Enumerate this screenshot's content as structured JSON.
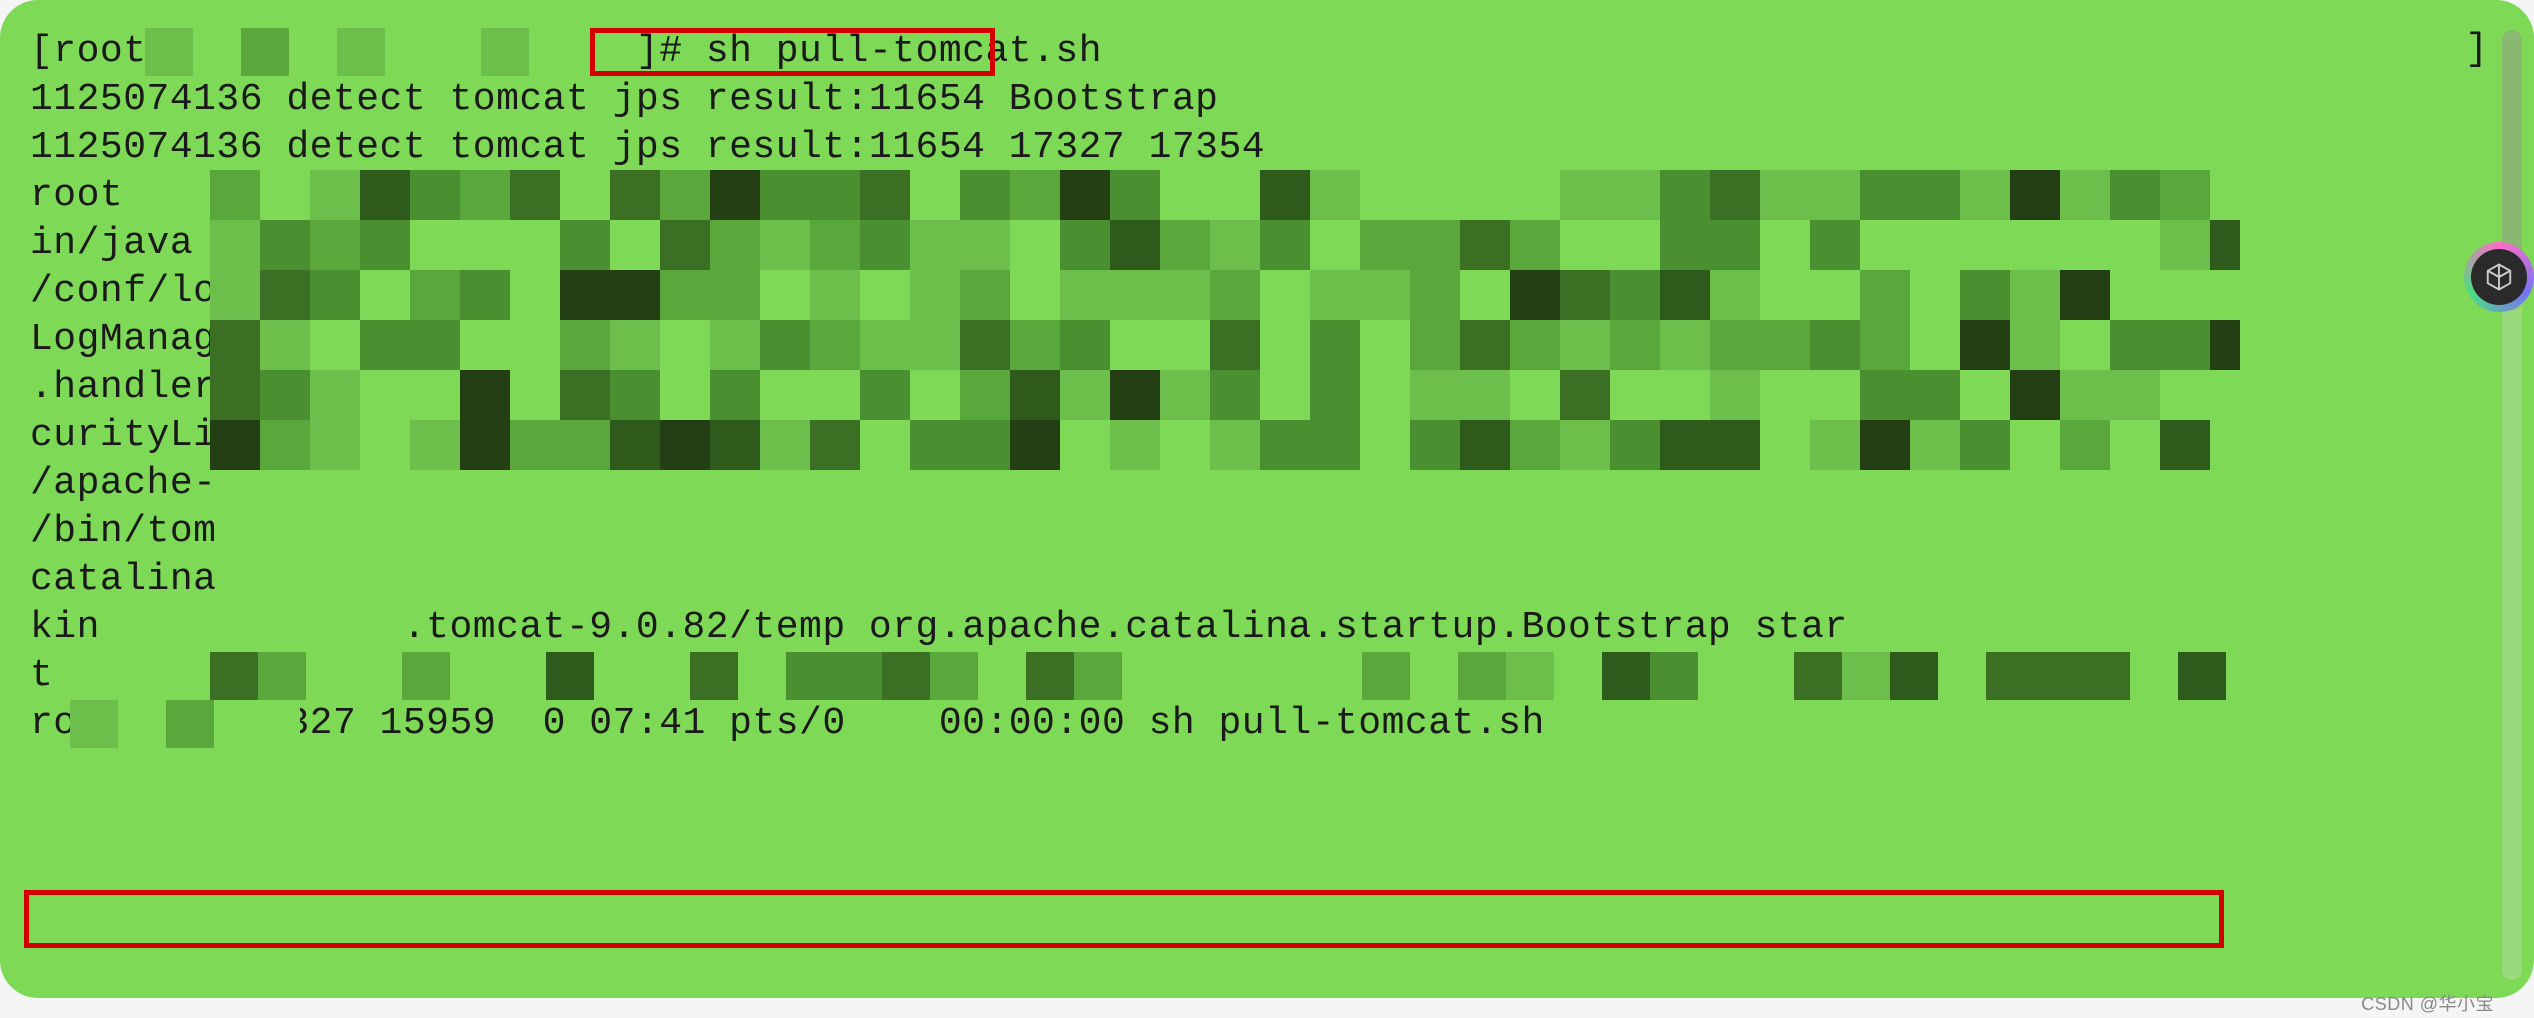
{
  "terminal": {
    "prompt_prefix": "[root(",
    "prompt_suffix": "]#",
    "command": "sh pull-tomcat.sh",
    "bracket_right": "]",
    "lines": [
      "1125074136 detect tomcat jps result:11654 Bootstrap",
      "1125074136 detect tomcat jps result:11654 17327 17354",
      "root",
      "in/java",
      "/conf/lo",
      "LogManag",
      ".handler",
      "curityLi",
      "/apache-",
      "/bin/tom",
      "catalina",
      "kin             .tomcat-9.0.82/temp org.apache.catalina.startup.Bootstrap star",
      "t",
      "root     17327 15959  0 07:41 pts/0    00:00:00 sh pull-tomcat.sh"
    ]
  },
  "pixelation": {
    "note": "censored/pixelated regions overlay",
    "colors": [
      "#7ED957",
      "#6BBF4A",
      "#5AA83C",
      "#4A8F30",
      "#3A6F24",
      "#2E5A1C",
      "#243F14",
      "#8DE066",
      "#A0E87E"
    ]
  },
  "badge": {
    "icon": "cube-icon"
  },
  "watermark": "CSDN @华小宝"
}
